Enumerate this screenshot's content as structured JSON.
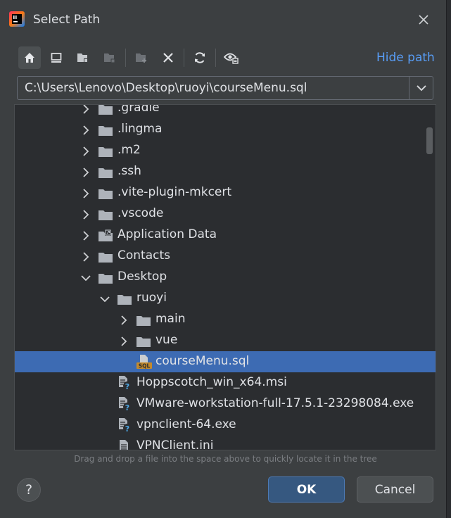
{
  "dialog": {
    "title": "Select Path",
    "hide_path_label": "Hide path",
    "path_value": "C:\\Users\\Lenovo\\Desktop\\ruoyi\\courseMenu.sql",
    "hint": "Drag and drop a file into the space above to quickly locate it in the tree",
    "ok_label": "OK",
    "cancel_label": "Cancel",
    "help_label": "?"
  },
  "toolbar": {
    "icons": [
      "home-icon",
      "desktop-icon",
      "project-folder-icon",
      "module-folder-icon",
      "new-folder-icon",
      "delete-icon",
      "refresh-icon",
      "show-hidden-icon"
    ]
  },
  "tree": {
    "rows": [
      {
        "label": ".gradle",
        "depth": 0,
        "kind": "folder",
        "expand": "collapsed"
      },
      {
        "label": ".lingma",
        "depth": 0,
        "kind": "folder",
        "expand": "collapsed"
      },
      {
        "label": ".m2",
        "depth": 0,
        "kind": "folder",
        "expand": "collapsed"
      },
      {
        "label": ".ssh",
        "depth": 0,
        "kind": "folder",
        "expand": "collapsed"
      },
      {
        "label": ".vite-plugin-mkcert",
        "depth": 0,
        "kind": "folder",
        "expand": "collapsed"
      },
      {
        "label": ".vscode",
        "depth": 0,
        "kind": "folder",
        "expand": "collapsed"
      },
      {
        "label": "Application Data",
        "depth": 0,
        "kind": "folder-link",
        "expand": "collapsed"
      },
      {
        "label": "Contacts",
        "depth": 0,
        "kind": "folder",
        "expand": "collapsed"
      },
      {
        "label": "Desktop",
        "depth": 0,
        "kind": "folder",
        "expand": "expanded"
      },
      {
        "label": "ruoyi",
        "depth": 1,
        "kind": "folder",
        "expand": "expanded"
      },
      {
        "label": "main",
        "depth": 2,
        "kind": "folder",
        "expand": "collapsed"
      },
      {
        "label": "vue",
        "depth": 2,
        "kind": "folder",
        "expand": "collapsed"
      },
      {
        "label": "courseMenu.sql",
        "depth": 2,
        "kind": "sql",
        "expand": "none",
        "selected": true
      },
      {
        "label": "Hoppscotch_win_x64.msi",
        "depth": 1,
        "kind": "unknown",
        "expand": "none"
      },
      {
        "label": "VMware-workstation-full-17.5.1-23298084.exe",
        "depth": 1,
        "kind": "unknown",
        "expand": "none"
      },
      {
        "label": "vpnclient-64.exe",
        "depth": 1,
        "kind": "unknown",
        "expand": "none"
      },
      {
        "label": "VPNClient.ini",
        "depth": 1,
        "kind": "text",
        "expand": "none"
      }
    ]
  },
  "colors": {
    "accent": "#589df6",
    "selection": "#3d6bb3",
    "ok_button": "#365880",
    "folder": "#aeb3ba"
  }
}
